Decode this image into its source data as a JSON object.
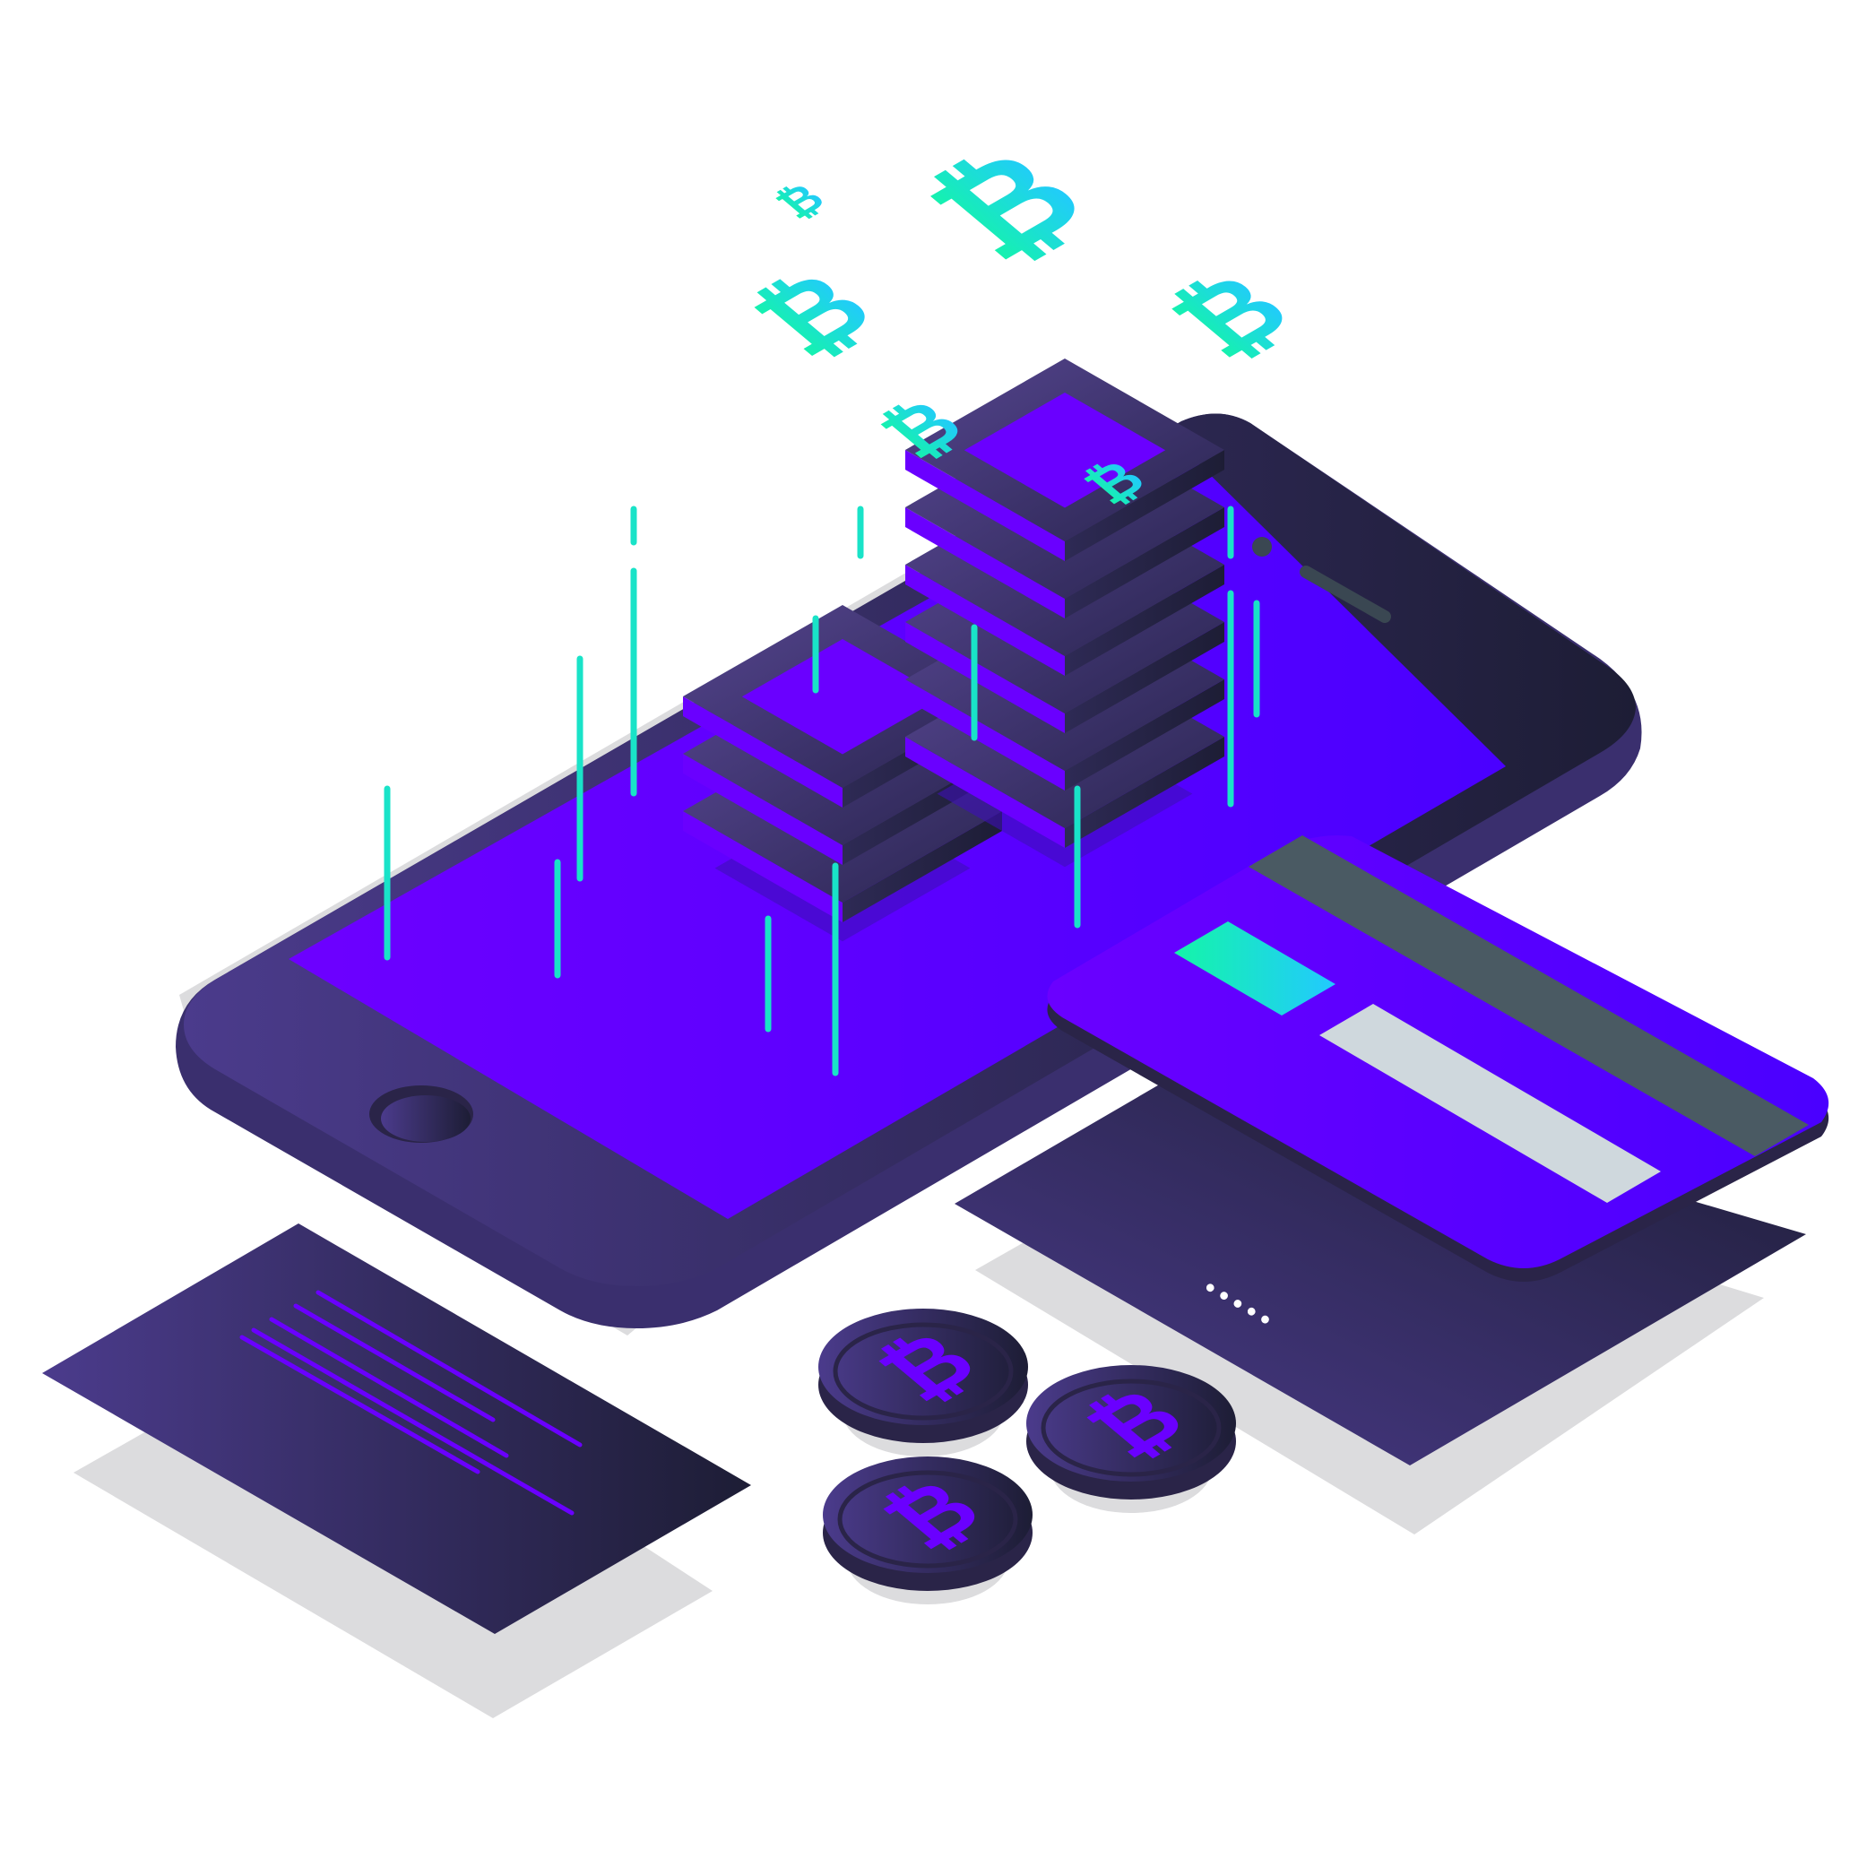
{
  "scene": {
    "description_tag": "",
    "background": "#ffffff"
  },
  "colors": {
    "violet": "#6a00ff",
    "blue_violet": "#4a00ff",
    "dark_navy": "#1d1d35",
    "purple_slate": "#4b3b8c",
    "teal": "#19e3c8",
    "mint": "#14f5a8",
    "sky": "#22c9ff",
    "shadow": "#dcdcde",
    "stripe_grey": "#4a5a63",
    "signature_grey": "#cfd8dd"
  },
  "icons": {
    "floating_symbol": "bitcoin-icon",
    "coin_symbol": "bitcoin-icon",
    "home_button": "home-button-icon"
  },
  "coins": [
    {
      "symbol": "₿"
    },
    {
      "symbol": "₿"
    },
    {
      "symbol": "₿"
    }
  ],
  "floating_symbols": [
    {
      "symbol": "₿"
    },
    {
      "symbol": "₿"
    },
    {
      "symbol": "₿"
    },
    {
      "symbol": "₿"
    },
    {
      "symbol": "₿"
    },
    {
      "symbol": "₿"
    }
  ],
  "card": {
    "dots": "•••••"
  }
}
